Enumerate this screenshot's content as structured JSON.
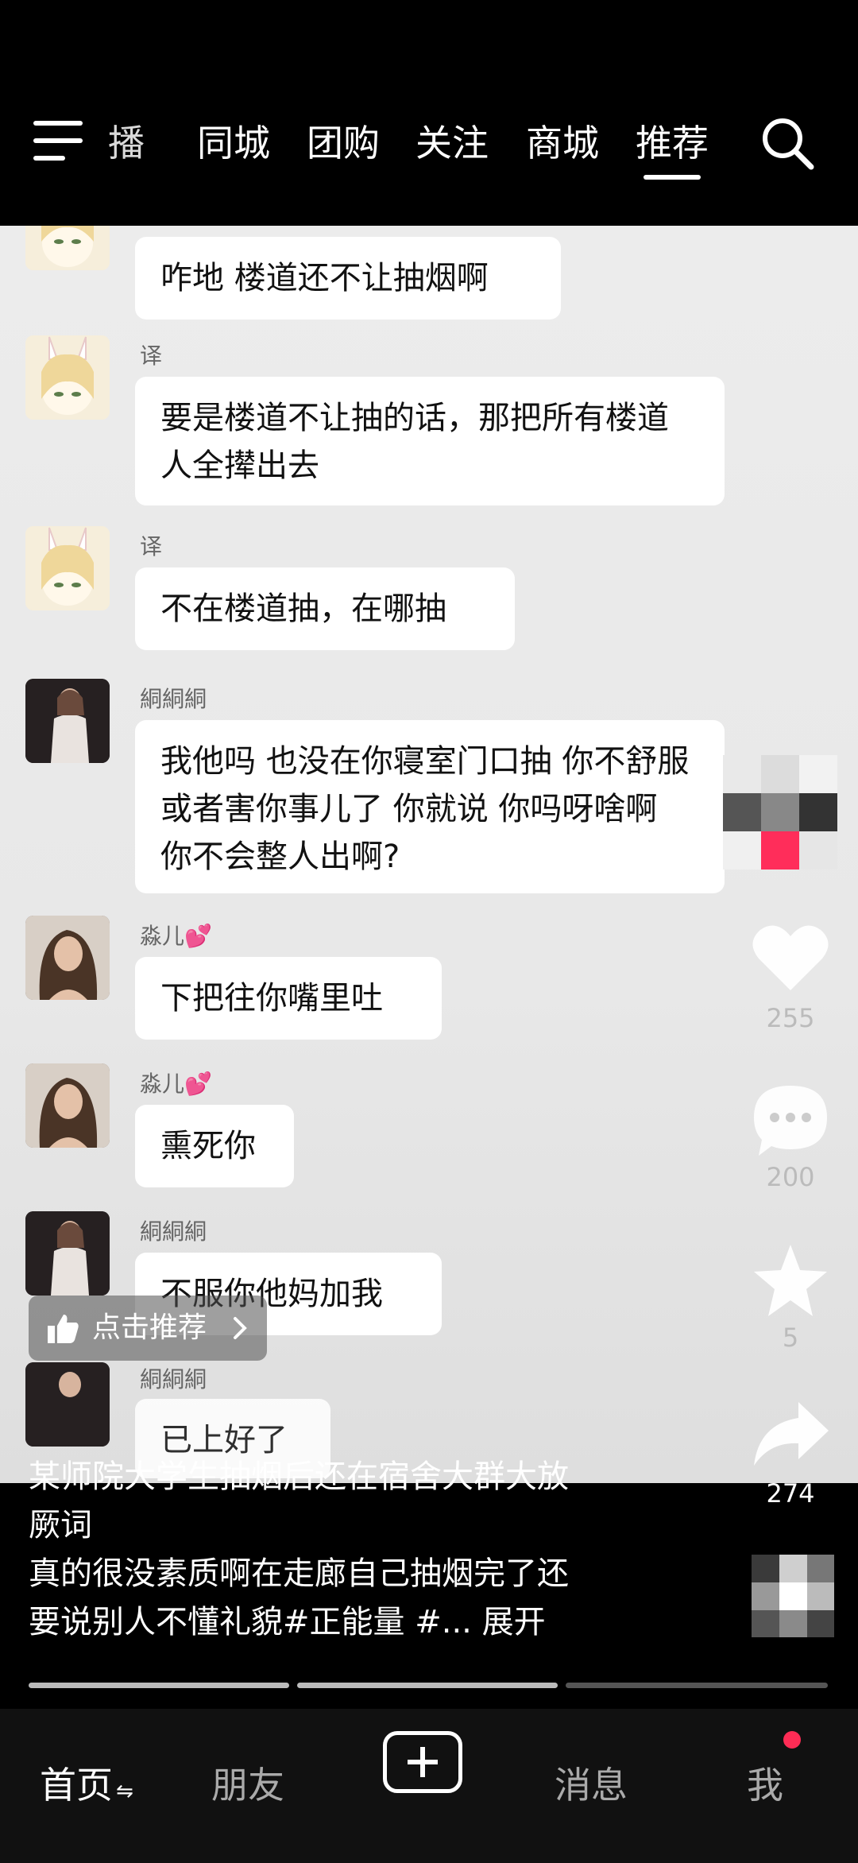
{
  "header": {
    "tabs": [
      "播",
      "同城",
      "团购",
      "关注",
      "商城",
      "推荐"
    ],
    "active_tab": "推荐"
  },
  "messages": [
    {
      "username": "",
      "text": "咋地 楼道还不让抽烟啊"
    },
    {
      "username": "译",
      "text": "要是楼道不让抽的话，那把所有楼道人全撵出去"
    },
    {
      "username": "译",
      "text": "不在楼道抽，在哪抽"
    },
    {
      "username": "絧絧絧",
      "text": "我他吗 也没在你寝室门口抽 你不舒服 或者害你事儿了 你就说 你吗呀啥啊 你不会整人出啊?"
    },
    {
      "username": "淼儿💕",
      "text": "下把往你嘴里吐"
    },
    {
      "username": "淼儿💕",
      "text": "熏死你"
    },
    {
      "username": "絧絧絧",
      "text": "不服你他妈加我"
    },
    {
      "username": "絧絧絧",
      "text": "已上好了"
    }
  ],
  "actions": {
    "like_count": "255",
    "comment_count": "200",
    "favorite_count": "5",
    "share_count": "274"
  },
  "recommend_label": "点击推荐",
  "caption": {
    "line1": "某师院大学生抽烟后还在宿舍大群大放",
    "line2": "厥词",
    "line3": "真的很没素质啊在走廊自己抽烟完了还",
    "line4": "要说别人不懂礼貌#正能量 #...",
    "expand": "展开"
  },
  "bottom_nav": {
    "home": "首页",
    "friends": "朋友",
    "messages": "消息",
    "me": "我"
  }
}
